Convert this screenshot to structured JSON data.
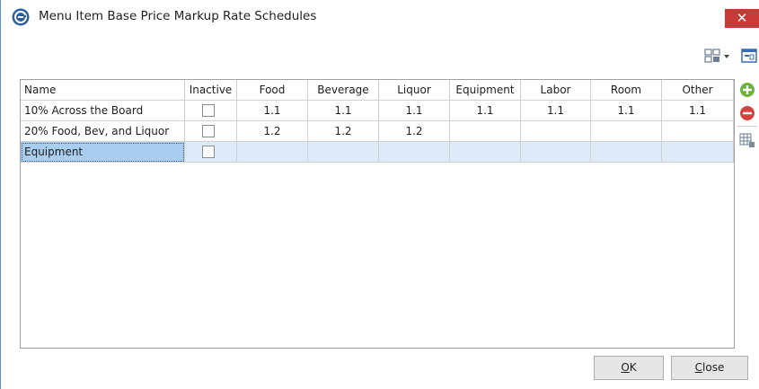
{
  "window": {
    "title": "Menu Item Base Price Markup Rate Schedules",
    "close_glyph": "✕"
  },
  "toolbar": {
    "icons": [
      "layout-chooser-icon",
      "dropdown-arrow-icon",
      "form-view-icon"
    ]
  },
  "grid": {
    "columns": [
      "Name",
      "Inactive",
      "Food",
      "Beverage",
      "Liquor",
      "Equipment",
      "Labor",
      "Room",
      "Other"
    ],
    "rows": [
      {
        "name": "10% Across the Board",
        "inactive": false,
        "food": "1.1",
        "beverage": "1.1",
        "liquor": "1.1",
        "equipment": "1.1",
        "labor": "1.1",
        "room": "1.1",
        "other": "1.1"
      },
      {
        "name": "20% Food, Bev, and Liquor",
        "inactive": false,
        "food": "1.2",
        "beverage": "1.2",
        "liquor": "1.2",
        "equipment": "",
        "labor": "",
        "room": "",
        "other": ""
      },
      {
        "name": "Equipment",
        "inactive": false,
        "food": "",
        "beverage": "",
        "liquor": "",
        "equipment": "",
        "labor": "",
        "room": "",
        "other": ""
      }
    ]
  },
  "side_actions": [
    "add-row-icon",
    "remove-row-icon",
    "grid-settings-icon"
  ],
  "buttons": {
    "ok_underline": "O",
    "ok_rest": "K",
    "close_underline": "C",
    "close_rest": "lose"
  },
  "colors": {
    "accent": "#5b8fd0",
    "close": "#c73a37",
    "selected_row": "#ddeaf7",
    "selected_cell": "#a9cdee",
    "add": "#6cb33f",
    "remove": "#d9433f"
  }
}
